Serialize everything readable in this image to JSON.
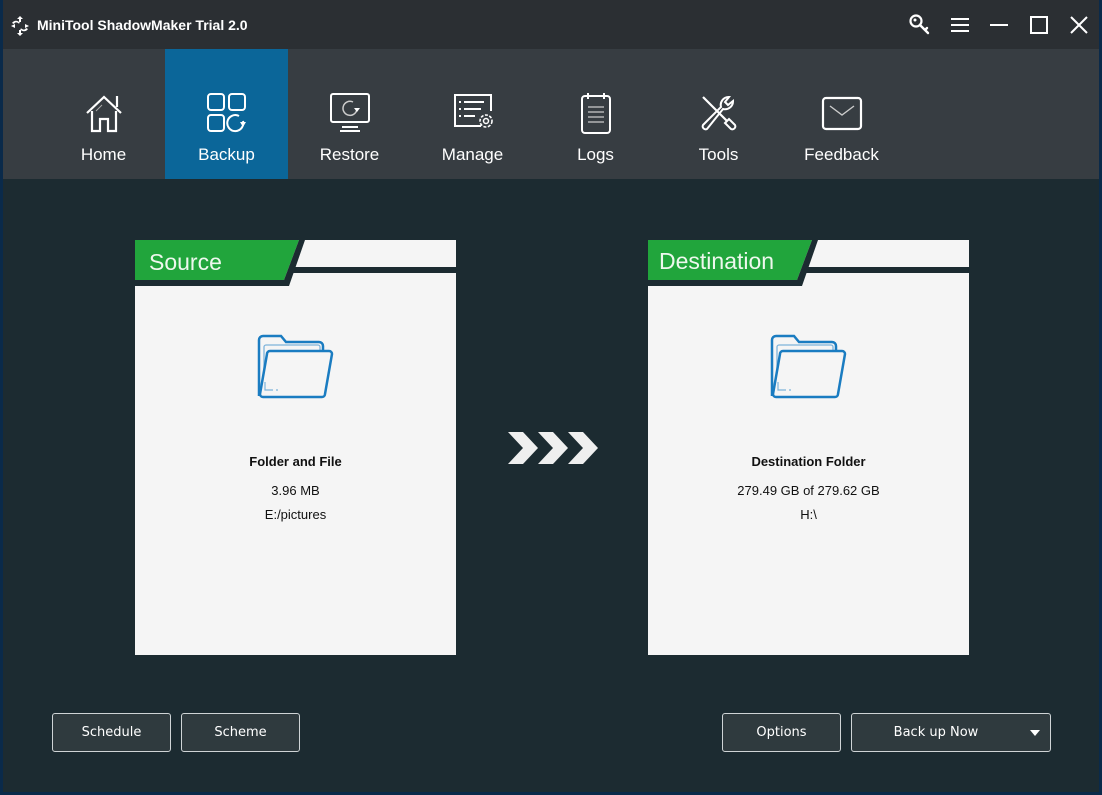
{
  "window": {
    "title": "MiniTool ShadowMaker Trial 2.0",
    "controls": [
      {
        "name": "register-key-icon"
      },
      {
        "name": "menu-icon"
      },
      {
        "name": "minimize-icon"
      },
      {
        "name": "maximize-icon"
      },
      {
        "name": "close-icon"
      }
    ]
  },
  "nav": {
    "active": "Backup",
    "items": [
      {
        "label": "Home",
        "icon": "home-icon"
      },
      {
        "label": "Backup",
        "icon": "backup-grid-icon"
      },
      {
        "label": "Restore",
        "icon": "monitor-restore-icon"
      },
      {
        "label": "Manage",
        "icon": "list-gear-icon"
      },
      {
        "label": "Logs",
        "icon": "notepad-icon"
      },
      {
        "label": "Tools",
        "icon": "wrench-screwdriver-icon"
      },
      {
        "label": "Feedback",
        "icon": "envelope-icon"
      }
    ]
  },
  "source": {
    "header": "Source",
    "icon": "folder-icon",
    "title": "Folder and File",
    "size": "3.96 MB",
    "path": "E:/pictures"
  },
  "destination": {
    "header": "Destination",
    "icon": "folder-icon",
    "title": "Destination Folder",
    "size": "279.49 GB of 279.62 GB",
    "path": "H:\\"
  },
  "buttons": {
    "schedule": "Schedule",
    "scheme": "Scheme",
    "options": "Options",
    "backup_now": "Back up Now"
  },
  "colors": {
    "accent_green": "#21a53c",
    "active_tab": "#0b6699",
    "folder_blue": "#1a7cc1",
    "background": "#1c2b31",
    "navbar": "#373d42",
    "titlebar": "#2b2f33"
  }
}
